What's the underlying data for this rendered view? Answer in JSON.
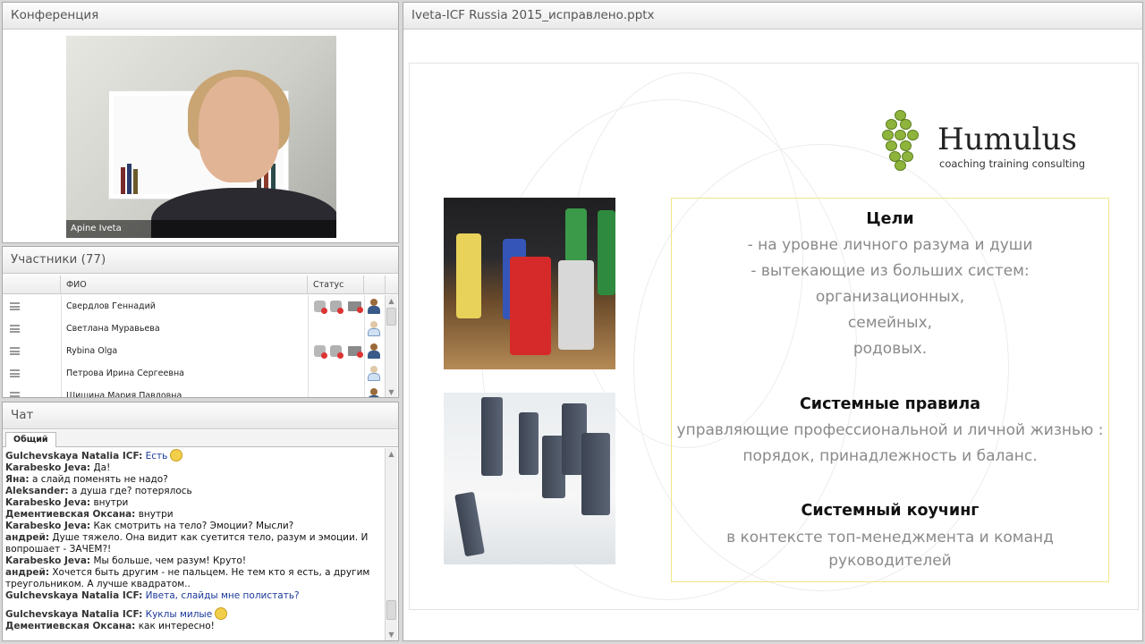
{
  "conference": {
    "title": "Конференция",
    "video_label": "Apine Iveta"
  },
  "participants": {
    "title": "Участники (77)",
    "columns": [
      "ФИО",
      "Статус"
    ],
    "rows": [
      {
        "name": "Свердлов Геннадий",
        "has_status": true,
        "user_icon": "user-dark-icon"
      },
      {
        "name": "Светлана Муравьева",
        "has_status": false,
        "user_icon": "user-light-icon"
      },
      {
        "name": "Rybina Olga",
        "has_status": true,
        "user_icon": "user-dark-icon"
      },
      {
        "name": "Петрова Ирина  Сергеевна",
        "has_status": false,
        "user_icon": "user-light-icon"
      },
      {
        "name": "Шишина Мария Павловна",
        "has_status": false,
        "user_icon": "user-dark-icon"
      }
    ]
  },
  "chat": {
    "title": "Чат",
    "tab": "Общий",
    "messages": [
      {
        "author": "Gulchevskaya Natalia ICF:",
        "text": "Есть",
        "link": true,
        "smiley": true
      },
      {
        "author": "Karabesko Jeva:",
        "text": "Да!"
      },
      {
        "author": "Яна:",
        "text": "а слайд поменять не надо?"
      },
      {
        "author": "Aleksander:",
        "text": "а душа где? потерялось"
      },
      {
        "author": "Karabesko Jeva:",
        "text": "внутри"
      },
      {
        "author": "Дементиевская Оксана:",
        "text": "внутри"
      },
      {
        "author": "Karabesko Jeva:",
        "text": "Как смотрить на тело? Эмоции? Мысли?"
      },
      {
        "author": "андрей:",
        "text": "Душе тяжело. Она видит как суетится тело, разум и эмоции. И вопрошает - ЗАЧЕМ?!"
      },
      {
        "author": "Karabesko Jeva:",
        "text": "Мы больше, чем разум!  Круто!"
      },
      {
        "author": "андрей:",
        "text": "Хочется быть другим - не пальцем. Не тем кто я есть, а другим треугольником. А лучше квадратом.."
      },
      {
        "author": "Gulchevskaya Natalia ICF:",
        "text": "Ивета, слайды мне полистать?",
        "link": true
      },
      {
        "author": "Gulchevskaya Natalia ICF:",
        "text": "Куклы милые",
        "link": true,
        "smiley": true
      },
      {
        "author": "Дементиевская Оксана:",
        "text": "как интересно!"
      }
    ]
  },
  "presentation": {
    "title": "Iveta-ICF Russia 2015_исправлено.pptx",
    "logo_name": "Humulus",
    "logo_sub": "coaching training consulting",
    "goals_title": "Цели",
    "goals": [
      "- на уровне личного разума и души",
      "- вытекающие из больших систем:",
      "организационных,",
      "семейных,",
      "родовых."
    ],
    "rules_title": "Системные правила",
    "rules": [
      "управляющие профессиональной и личной жизнью :",
      "порядок, принадлежность и баланс."
    ],
    "coaching_title": "Системный коучинг",
    "coaching": [
      "в контексте топ-менеджмента и команд",
      "руководителей"
    ],
    "colors": {
      "frame": "#efe58a",
      "body_text": "#8a8a8a",
      "logo_green": "#8fb43c"
    }
  }
}
